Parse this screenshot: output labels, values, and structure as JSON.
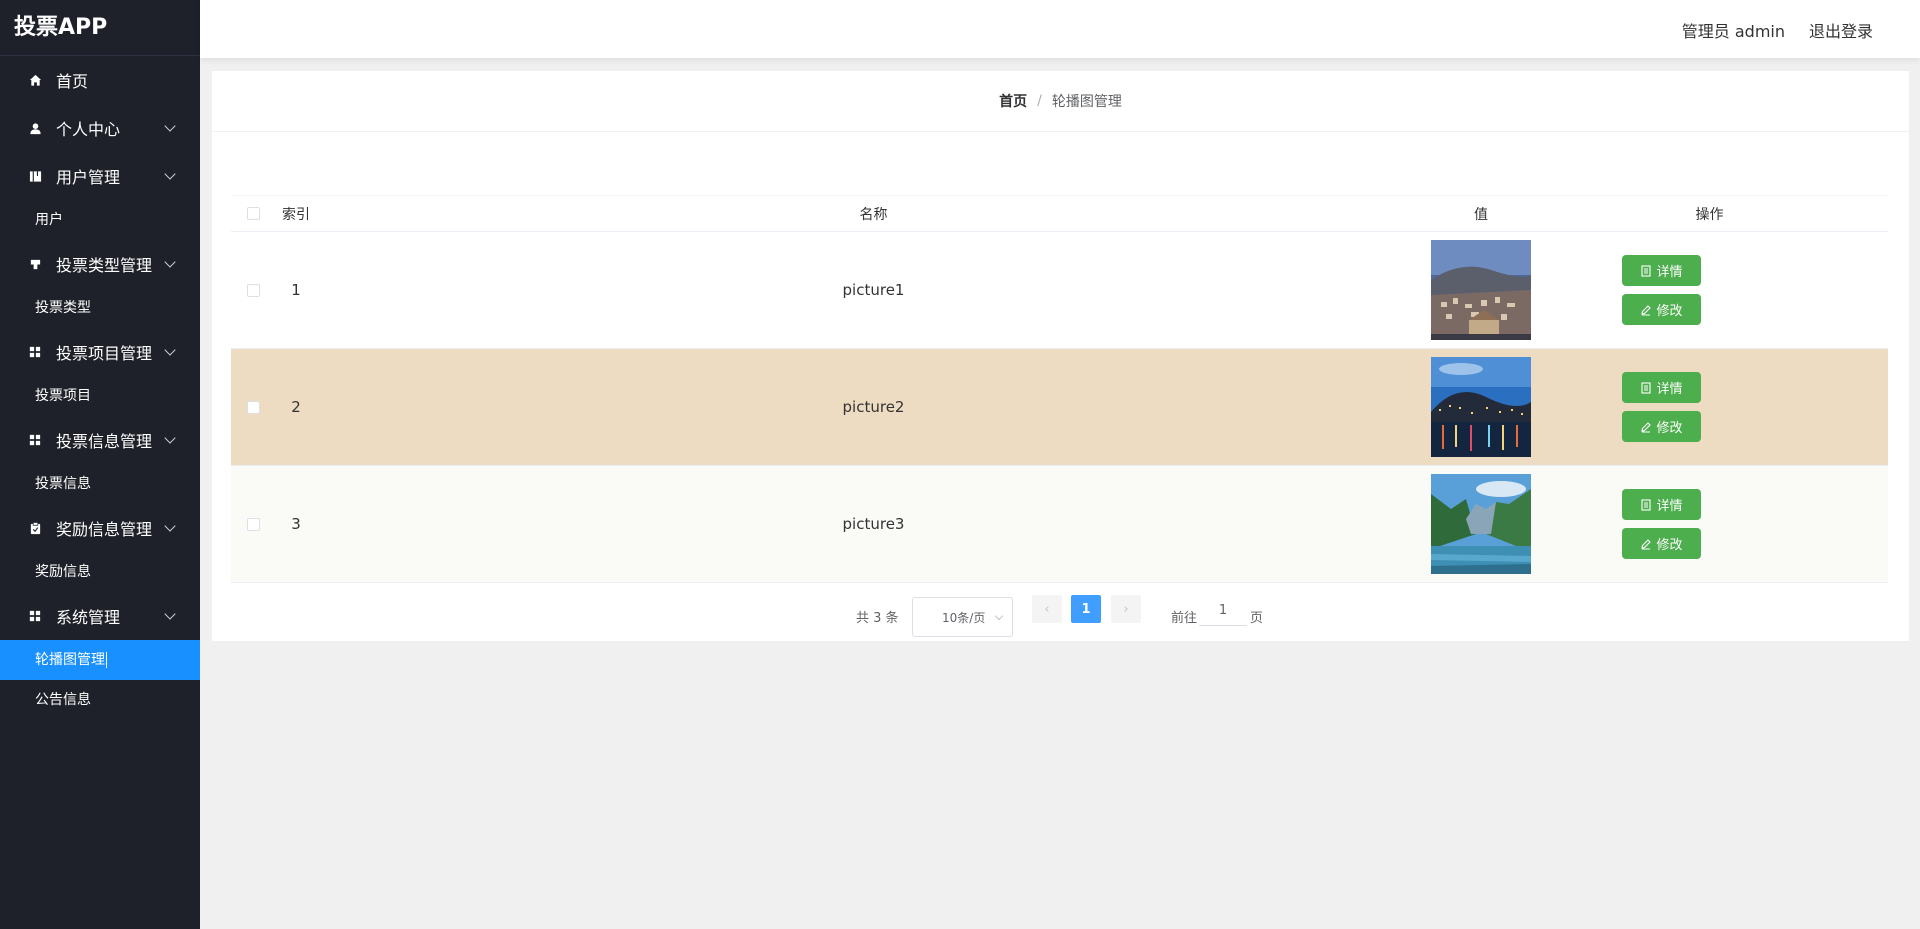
{
  "app": {
    "title": "投票APP"
  },
  "sidebar": {
    "items": [
      {
        "label": "首页",
        "icon": "home-icon"
      },
      {
        "label": "个人中心",
        "icon": "user-icon"
      },
      {
        "label": "用户管理",
        "icon": "user-manage-icon",
        "sub": [
          "用户"
        ]
      },
      {
        "label": "投票类型管理",
        "icon": "vote-type-icon",
        "sub": [
          "投票类型"
        ]
      },
      {
        "label": "投票项目管理",
        "icon": "grid-icon",
        "sub": [
          "投票项目"
        ]
      },
      {
        "label": "投票信息管理",
        "icon": "grid-icon",
        "sub": [
          "投票信息"
        ]
      },
      {
        "label": "奖励信息管理",
        "icon": "clipboard-icon",
        "sub": [
          "奖励信息"
        ]
      },
      {
        "label": "系统管理",
        "icon": "grid-icon",
        "sub": [
          "轮播图管理",
          "公告信息"
        ]
      }
    ],
    "labels": {
      "home": "首页",
      "profile": "个人中心",
      "user_mgmt": "用户管理",
      "user": "用户",
      "vote_type_mgmt": "投票类型管理",
      "vote_type": "投票类型",
      "vote_project_mgmt": "投票项目管理",
      "vote_project": "投票项目",
      "vote_info_mgmt": "投票信息管理",
      "vote_info": "投票信息",
      "reward_mgmt": "奖励信息管理",
      "reward": "奖励信息",
      "system_mgmt": "系统管理",
      "carousel": "轮播图管理",
      "notice": "公告信息"
    },
    "active": "轮播图管理",
    "active_color": "#1890ff",
    "bg_color": "#1e212a"
  },
  "header": {
    "admin_label": "管理员 admin",
    "logout_label": "退出登录"
  },
  "breadcrumb": {
    "home": "首页",
    "separator": "/",
    "current": "轮播图管理"
  },
  "table": {
    "columns": [
      "索引",
      "名称",
      "值",
      "操作"
    ],
    "rows": [
      {
        "index": "1",
        "name": "picture1",
        "detail_label": "详情",
        "edit_label": "修改"
      },
      {
        "index": "2",
        "name": "picture2",
        "detail_label": "详情",
        "edit_label": "修改"
      },
      {
        "index": "3",
        "name": "picture3",
        "detail_label": "详情",
        "edit_label": "修改"
      }
    ],
    "button_color": "#4cae4c",
    "highlight_row_color": "#eddcc2"
  },
  "pagination": {
    "total_text": "共 3 条",
    "page_size": "10条/页",
    "prev": "‹",
    "current_page": "1",
    "next": "›",
    "goto_prefix": "前往",
    "goto_value": "1",
    "goto_suffix": "页"
  }
}
